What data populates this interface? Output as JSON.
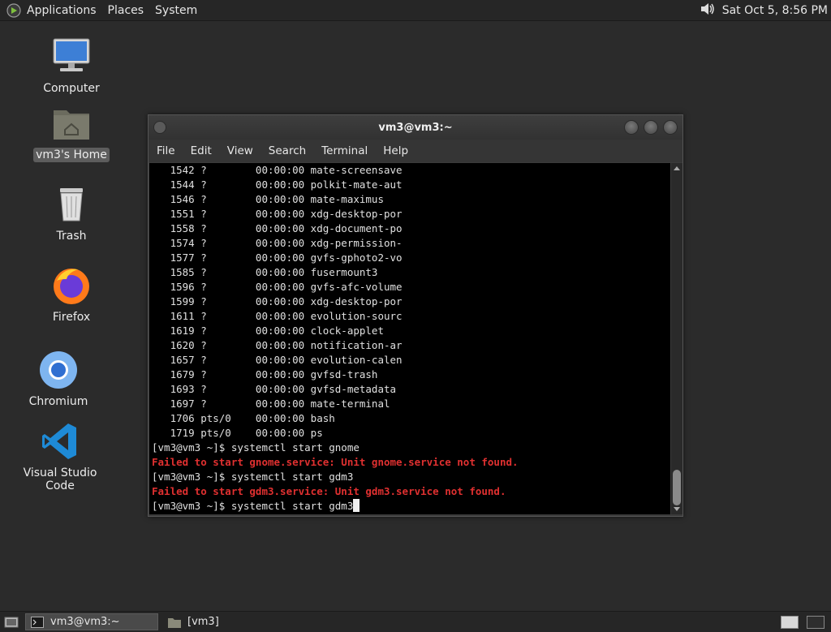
{
  "top_panel": {
    "menus": [
      "Applications",
      "Places",
      "System"
    ],
    "volume_icon": "speaker-icon",
    "clock": "Sat Oct  5,  8:56 PM"
  },
  "desktop": {
    "icons": [
      {
        "label": "Computer",
        "icon": "computer-icon"
      },
      {
        "label": "vm3's Home",
        "icon": "home-folder-icon"
      },
      {
        "label": "Trash",
        "icon": "trash-icon"
      },
      {
        "label": "Firefox",
        "icon": "firefox-icon"
      },
      {
        "label": "Chromium",
        "icon": "chromium-icon"
      },
      {
        "label": "Visual Studio Code",
        "icon": "vscode-icon"
      }
    ]
  },
  "terminal": {
    "title": "vm3@vm3:~",
    "menu": [
      "File",
      "Edit",
      "View",
      "Search",
      "Terminal",
      "Help"
    ],
    "lines": [
      {
        "text": "   1542 ?        00:00:00 mate-screensave",
        "error": false
      },
      {
        "text": "   1544 ?        00:00:00 polkit-mate-aut",
        "error": false
      },
      {
        "text": "   1546 ?        00:00:00 mate-maximus",
        "error": false
      },
      {
        "text": "   1551 ?        00:00:00 xdg-desktop-por",
        "error": false
      },
      {
        "text": "   1558 ?        00:00:00 xdg-document-po",
        "error": false
      },
      {
        "text": "   1574 ?        00:00:00 xdg-permission-",
        "error": false
      },
      {
        "text": "   1577 ?        00:00:00 gvfs-gphoto2-vo",
        "error": false
      },
      {
        "text": "   1585 ?        00:00:00 fusermount3",
        "error": false
      },
      {
        "text": "   1596 ?        00:00:00 gvfs-afc-volume",
        "error": false
      },
      {
        "text": "   1599 ?        00:00:00 xdg-desktop-por",
        "error": false
      },
      {
        "text": "   1611 ?        00:00:00 evolution-sourc",
        "error": false
      },
      {
        "text": "   1619 ?        00:00:00 clock-applet",
        "error": false
      },
      {
        "text": "   1620 ?        00:00:00 notification-ar",
        "error": false
      },
      {
        "text": "   1657 ?        00:00:00 evolution-calen",
        "error": false
      },
      {
        "text": "   1679 ?        00:00:00 gvfsd-trash",
        "error": false
      },
      {
        "text": "   1693 ?        00:00:00 gvfsd-metadata",
        "error": false
      },
      {
        "text": "   1697 ?        00:00:00 mate-terminal",
        "error": false
      },
      {
        "text": "   1706 pts/0    00:00:00 bash",
        "error": false
      },
      {
        "text": "   1719 pts/0    00:00:00 ps",
        "error": false
      },
      {
        "text": "[vm3@vm3 ~]$ systemctl start gnome",
        "error": false
      },
      {
        "text": "Failed to start gnome.service: Unit gnome.service not found.",
        "error": true
      },
      {
        "text": "[vm3@vm3 ~]$ systemctl start gdm3",
        "error": false
      },
      {
        "text": "Failed to start gdm3.service: Unit gdm3.service not found.",
        "error": true
      }
    ],
    "current_prompt": "[vm3@vm3 ~]$ systemctl start gdm3",
    "colors": {
      "error": "#e03030",
      "background": "#000000",
      "foreground": "#e0e0e0"
    }
  },
  "bottom_panel": {
    "tasks": [
      {
        "label": "vm3@vm3:~",
        "icon": "terminal-icon",
        "active": true
      },
      {
        "label": "[vm3]",
        "icon": "folder-icon",
        "active": false
      }
    ],
    "workspaces": 2
  }
}
